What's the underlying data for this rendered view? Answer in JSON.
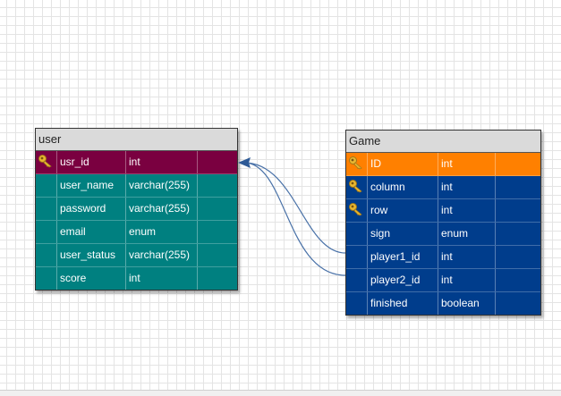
{
  "colors": {
    "user_body": "#008080",
    "user_pk_row": "#7a0040",
    "game_body": "#003d8c",
    "game_pk_row": "#ff8000",
    "connector": "#4a72a8",
    "key_icon": "#e8b830"
  },
  "user_table": {
    "title": "user",
    "rows": [
      {
        "key": true,
        "name": "usr_id",
        "type": "int"
      },
      {
        "key": false,
        "name": "user_name",
        "type": "varchar(255)"
      },
      {
        "key": false,
        "name": "password",
        "type": "varchar(255)"
      },
      {
        "key": false,
        "name": "email",
        "type": "enum"
      },
      {
        "key": false,
        "name": "user_status",
        "type": "varchar(255)"
      },
      {
        "key": false,
        "name": "score",
        "type": "int"
      }
    ]
  },
  "game_table": {
    "title": "Game",
    "rows": [
      {
        "key": true,
        "name": "ID",
        "type": "int"
      },
      {
        "key": true,
        "name": "column",
        "type": "int"
      },
      {
        "key": true,
        "name": "row",
        "type": "int"
      },
      {
        "key": false,
        "name": "sign",
        "type": "enum"
      },
      {
        "key": false,
        "name": "player1_id",
        "type": "int"
      },
      {
        "key": false,
        "name": "player2_id",
        "type": "int"
      },
      {
        "key": false,
        "name": "finished",
        "type": "boolean"
      }
    ]
  },
  "relations": [
    {
      "from": "game.player1_id",
      "to": "user.usr_id"
    },
    {
      "from": "game.player2_id",
      "to": "user.usr_id"
    }
  ]
}
